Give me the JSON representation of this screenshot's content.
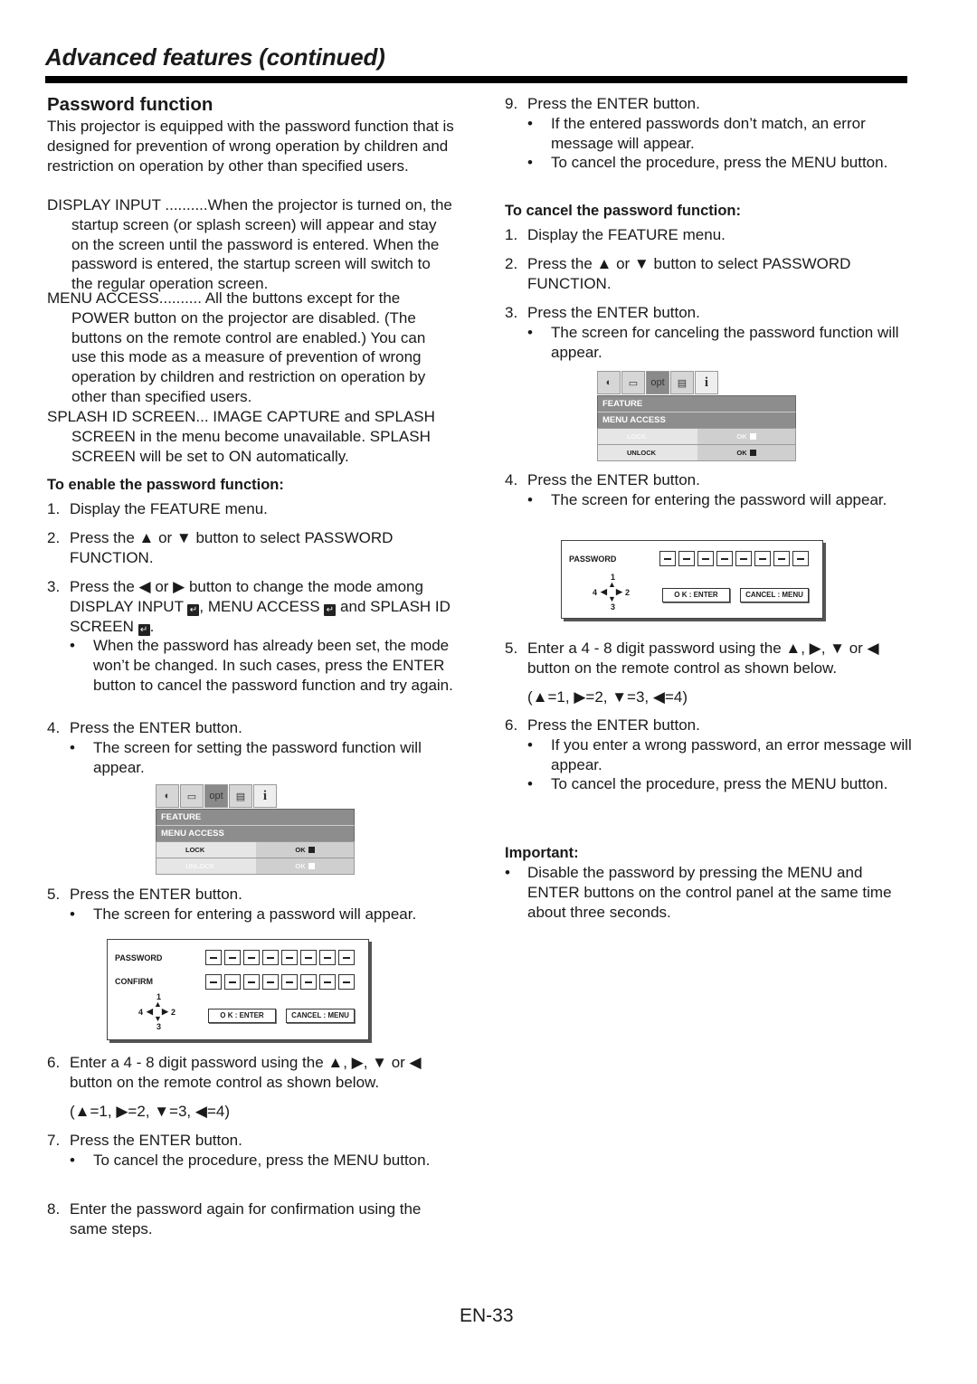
{
  "header": {
    "title": "Advanced features (continued)"
  },
  "section": {
    "title": "Password function",
    "intro": "This projector is equipped with the password function that is designed for prevention of wrong operation by children and restriction on operation by other than specified users.",
    "modes": [
      {
        "term": "DISPLAY INPUT ..........",
        "desc": "When the projector is turned on, the startup screen (or splash screen) will appear and stay on the screen until the password is entered. When the password is entered, the startup screen will switch to the regular operation screen."
      },
      {
        "term": "MENU ACCESS..........",
        "desc": " All the buttons except for the POWER button on the projector are disabled. (The buttons on the remote control are enabled.) You can use this mode as a measure of prevention of wrong operation by children and restriction on operation by other than specified users."
      },
      {
        "term": "SPLASH ID SCREEN...",
        "desc": " IMAGE CAPTURE and SPLASH SCREEN in the menu become unavailable. SPLASH SCREEN will be set to ON automatically."
      }
    ]
  },
  "enable": {
    "heading": "To enable the password function:",
    "steps": [
      {
        "num": "1.",
        "text": "Display the FEATURE menu."
      },
      {
        "num": "2.",
        "text": "Press the ▲ or ▼ button to select PASSWORD FUNCTION."
      },
      {
        "num": "3.",
        "text_a": "Press the ◀ or ▶ button to change the mode among DISPLAY INPUT ",
        "text_b": ", MENU ACCESS ",
        "text_c": " and SPLASH ID SCREEN ",
        "text_d": ".",
        "bullets": [
          "When the password has already been set, the mode won’t be changed. In such cases, press the ENTER button to cancel the password function and try again."
        ]
      },
      {
        "num": "4.",
        "text": "Press the ENTER button.",
        "bullets": [
          "The screen for setting the password function will appear."
        ]
      },
      {
        "num": "5.",
        "text": "Press the ENTER button.",
        "bullets": [
          "The screen for entering a password will appear."
        ]
      },
      {
        "num": "6.",
        "text": "Enter a 4 - 8 digit password using the ▲, ▶, ▼ or ◀ button on the remote control as shown below.",
        "code": "(▲=1, ▶=2, ▼=3, ◀=4)"
      },
      {
        "num": "7.",
        "text": "Press the ENTER button.",
        "bullets": [
          "To cancel the procedure, press the MENU button."
        ]
      },
      {
        "num": "8.",
        "text": "Enter the password again for confirmation using the same steps."
      },
      {
        "num": "9.",
        "text": "Press the ENTER button.",
        "bullets": [
          "If the entered passwords don’t match, an error message will appear.",
          "To cancel the procedure, press the MENU button."
        ]
      }
    ]
  },
  "cancel": {
    "heading": "To cancel the password function:",
    "steps": [
      {
        "num": "1.",
        "text": "Display the FEATURE menu."
      },
      {
        "num": "2.",
        "text": "Press the ▲ or ▼ button to select PASSWORD FUNCTION."
      },
      {
        "num": "3.",
        "text": "Press the ENTER button.",
        "bullets": [
          "The screen for canceling the password function will appear."
        ]
      },
      {
        "num": "4.",
        "text": "Press the ENTER button.",
        "bullets": [
          "The screen for entering the password will appear."
        ]
      },
      {
        "num": "5.",
        "text": "Enter a 4 - 8 digit password using the ▲, ▶, ▼ or ◀ button on the remote control as shown below.",
        "code": "(▲=1, ▶=2, ▼=3, ◀=4)"
      },
      {
        "num": "6.",
        "text": "Press the ENTER button.",
        "bullets": [
          "If you enter a wrong password, an error message will appear.",
          "To cancel the procedure, press the MENU button."
        ]
      }
    ]
  },
  "important": {
    "heading": "Important:",
    "bullets": [
      "Disable the password by pressing the MENU and ENTER buttons on the control panel at the same time about three seconds."
    ]
  },
  "osd_enable": {
    "tabs": [
      "picture-icon",
      "image-icon",
      "opt",
      "installation-icon",
      "i"
    ],
    "menu": "FEATURE",
    "submenu": "MENU ACCESS",
    "rows": [
      {
        "label": "LOCK",
        "value": "OK",
        "state": "selected"
      },
      {
        "label": "UNLOCK",
        "value": "OK",
        "state": "dimmed"
      }
    ]
  },
  "osd_cancel": {
    "tabs": [
      "picture-icon",
      "image-icon",
      "opt",
      "installation-icon",
      "i"
    ],
    "menu": "FEATURE",
    "submenu": "MENU ACCESS",
    "rows": [
      {
        "label": "LOCK",
        "value": "OK",
        "state": "dimmed"
      },
      {
        "label": "UNLOCK",
        "value": "OK",
        "state": "selected"
      }
    ]
  },
  "pwd_enable": {
    "password_label": "PASSWORD",
    "confirm_label": "CONFIRM",
    "placeholder_digit": "–",
    "digit_count": 8,
    "ok_label": "O K : ENTER",
    "cancel_label": "CANCEL : MENU",
    "dpad": {
      "up": "1",
      "right": "2",
      "down": "3",
      "left": "4"
    }
  },
  "pwd_cancel": {
    "password_label": "PASSWORD",
    "placeholder_digit": "–",
    "digit_count": 8,
    "ok_label": "O K : ENTER",
    "cancel_label": "CANCEL : MENU",
    "dpad": {
      "up": "1",
      "right": "2",
      "down": "3",
      "left": "4"
    }
  },
  "footer": {
    "page_number": "EN-33"
  }
}
